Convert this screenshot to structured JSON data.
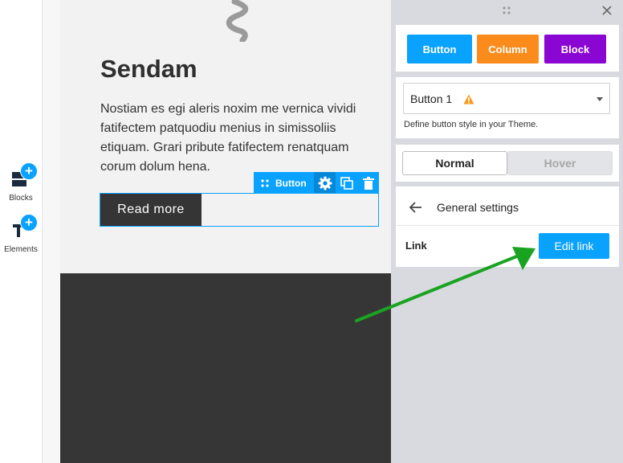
{
  "sidebar": {
    "blocks_label": "Blocks",
    "elements_label": "Elements"
  },
  "canvas": {
    "heading": "Sendam",
    "paragraph": "Nostiam es egi aleris noxim me vernica vividi fatifectem patquodiu menius in simissoliis etiquam. Grari pribute fatifectem renatquam corum dolum hena.",
    "toolbar_label": "Button",
    "button_text": "Read more"
  },
  "panel": {
    "type_buttons": {
      "button": "Button",
      "column": "Column",
      "block": "Block"
    },
    "style_select": {
      "value": "Button 1",
      "hint": "Define button style in your Theme."
    },
    "state_tabs": {
      "normal": "Normal",
      "hover": "Hover"
    },
    "general_settings": {
      "title": "General settings",
      "link_label": "Link",
      "edit_link": "Edit link"
    }
  },
  "colors": {
    "accent": "#0aa2ff",
    "button": "#0aa2ff",
    "column": "#fb8c1c",
    "block": "#8a06d3",
    "annotation_arrow": "#1aa321"
  },
  "icons": [
    "plus-icon",
    "blocks-icon",
    "text-icon",
    "wave-icon",
    "drag-handle-icon",
    "gear-icon",
    "copy-icon",
    "trash-icon",
    "close-icon",
    "warning-icon",
    "chevron-down-icon",
    "arrow-left-icon"
  ]
}
